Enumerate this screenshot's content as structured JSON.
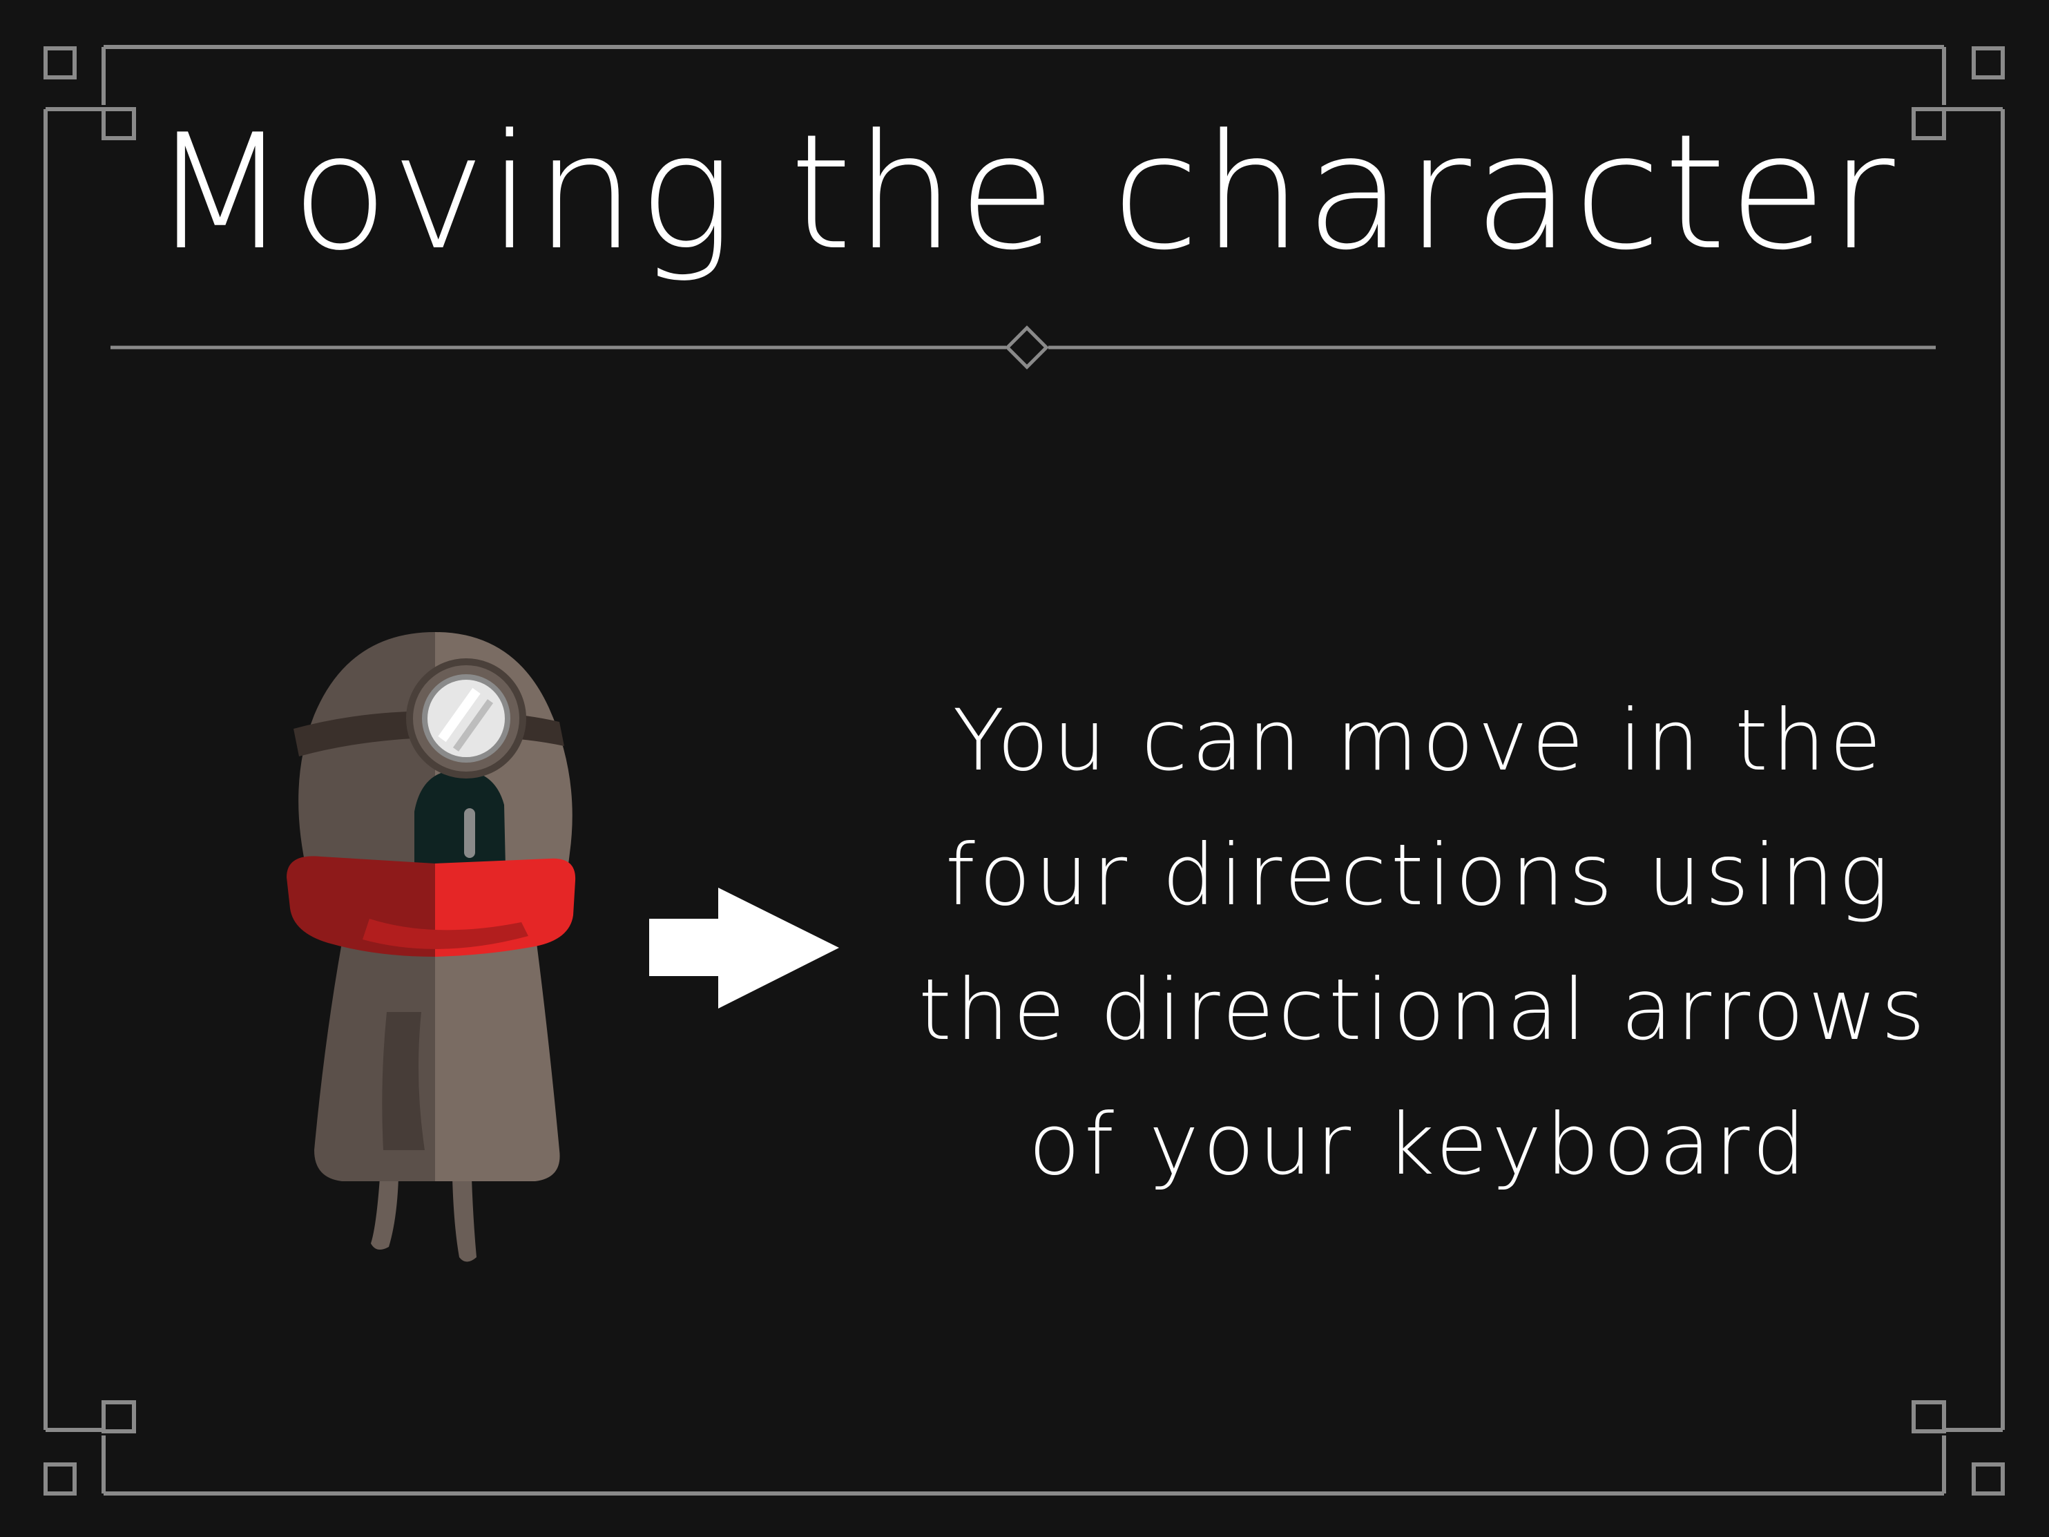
{
  "slide": {
    "title": "Moving the character",
    "instruction_lines": [
      "You can move in the",
      "four directions using",
      "the directional arrows",
      "of your keyboard"
    ]
  },
  "icons": {
    "character": "miner-character-icon",
    "arrow": "right-arrow-icon",
    "divider": "diamond-divider-icon"
  },
  "colors": {
    "background": "#131313",
    "frame": "#8a8a8a",
    "text": "#ffffff",
    "scarf": "#e52626",
    "coat": "#7a6c63"
  }
}
